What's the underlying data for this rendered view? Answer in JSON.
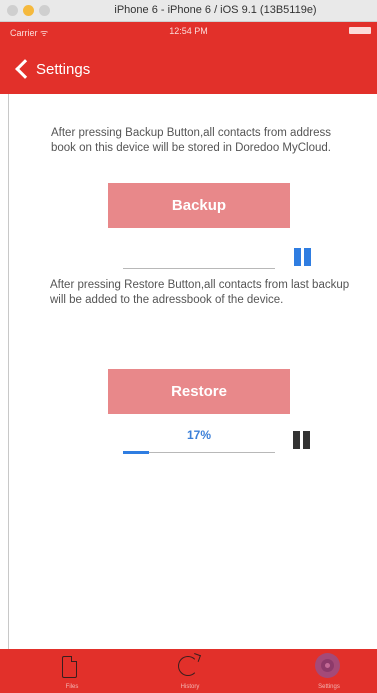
{
  "window": {
    "title": "iPhone 6 - iPhone 6 / iOS 9.1 (13B5119e)"
  },
  "status_bar": {
    "carrier": "Carrier ᯤ",
    "time": "12:54 PM"
  },
  "nav": {
    "back_label": "Settings"
  },
  "backup": {
    "description": "After pressing Backup Button,all contacts from address book on this device will be stored in Doredoo MyCloud.",
    "button_label": "Backup",
    "progress": 0
  },
  "restore": {
    "description": "After pressing Restore Button,all contacts from last backup will be added to the adressbook of the device.",
    "button_label": "Restore",
    "progress_text": "17%",
    "progress": 0.17
  },
  "tabs": [
    {
      "label": "Files",
      "icon": "document-icon"
    },
    {
      "label": "History",
      "icon": "history-icon"
    },
    {
      "label": "Settings",
      "icon": "gear-icon",
      "active": true
    }
  ],
  "colors": {
    "nav_red": "#e2302a",
    "button_pink": "#e8888a",
    "progress_blue": "#2f7de1"
  }
}
